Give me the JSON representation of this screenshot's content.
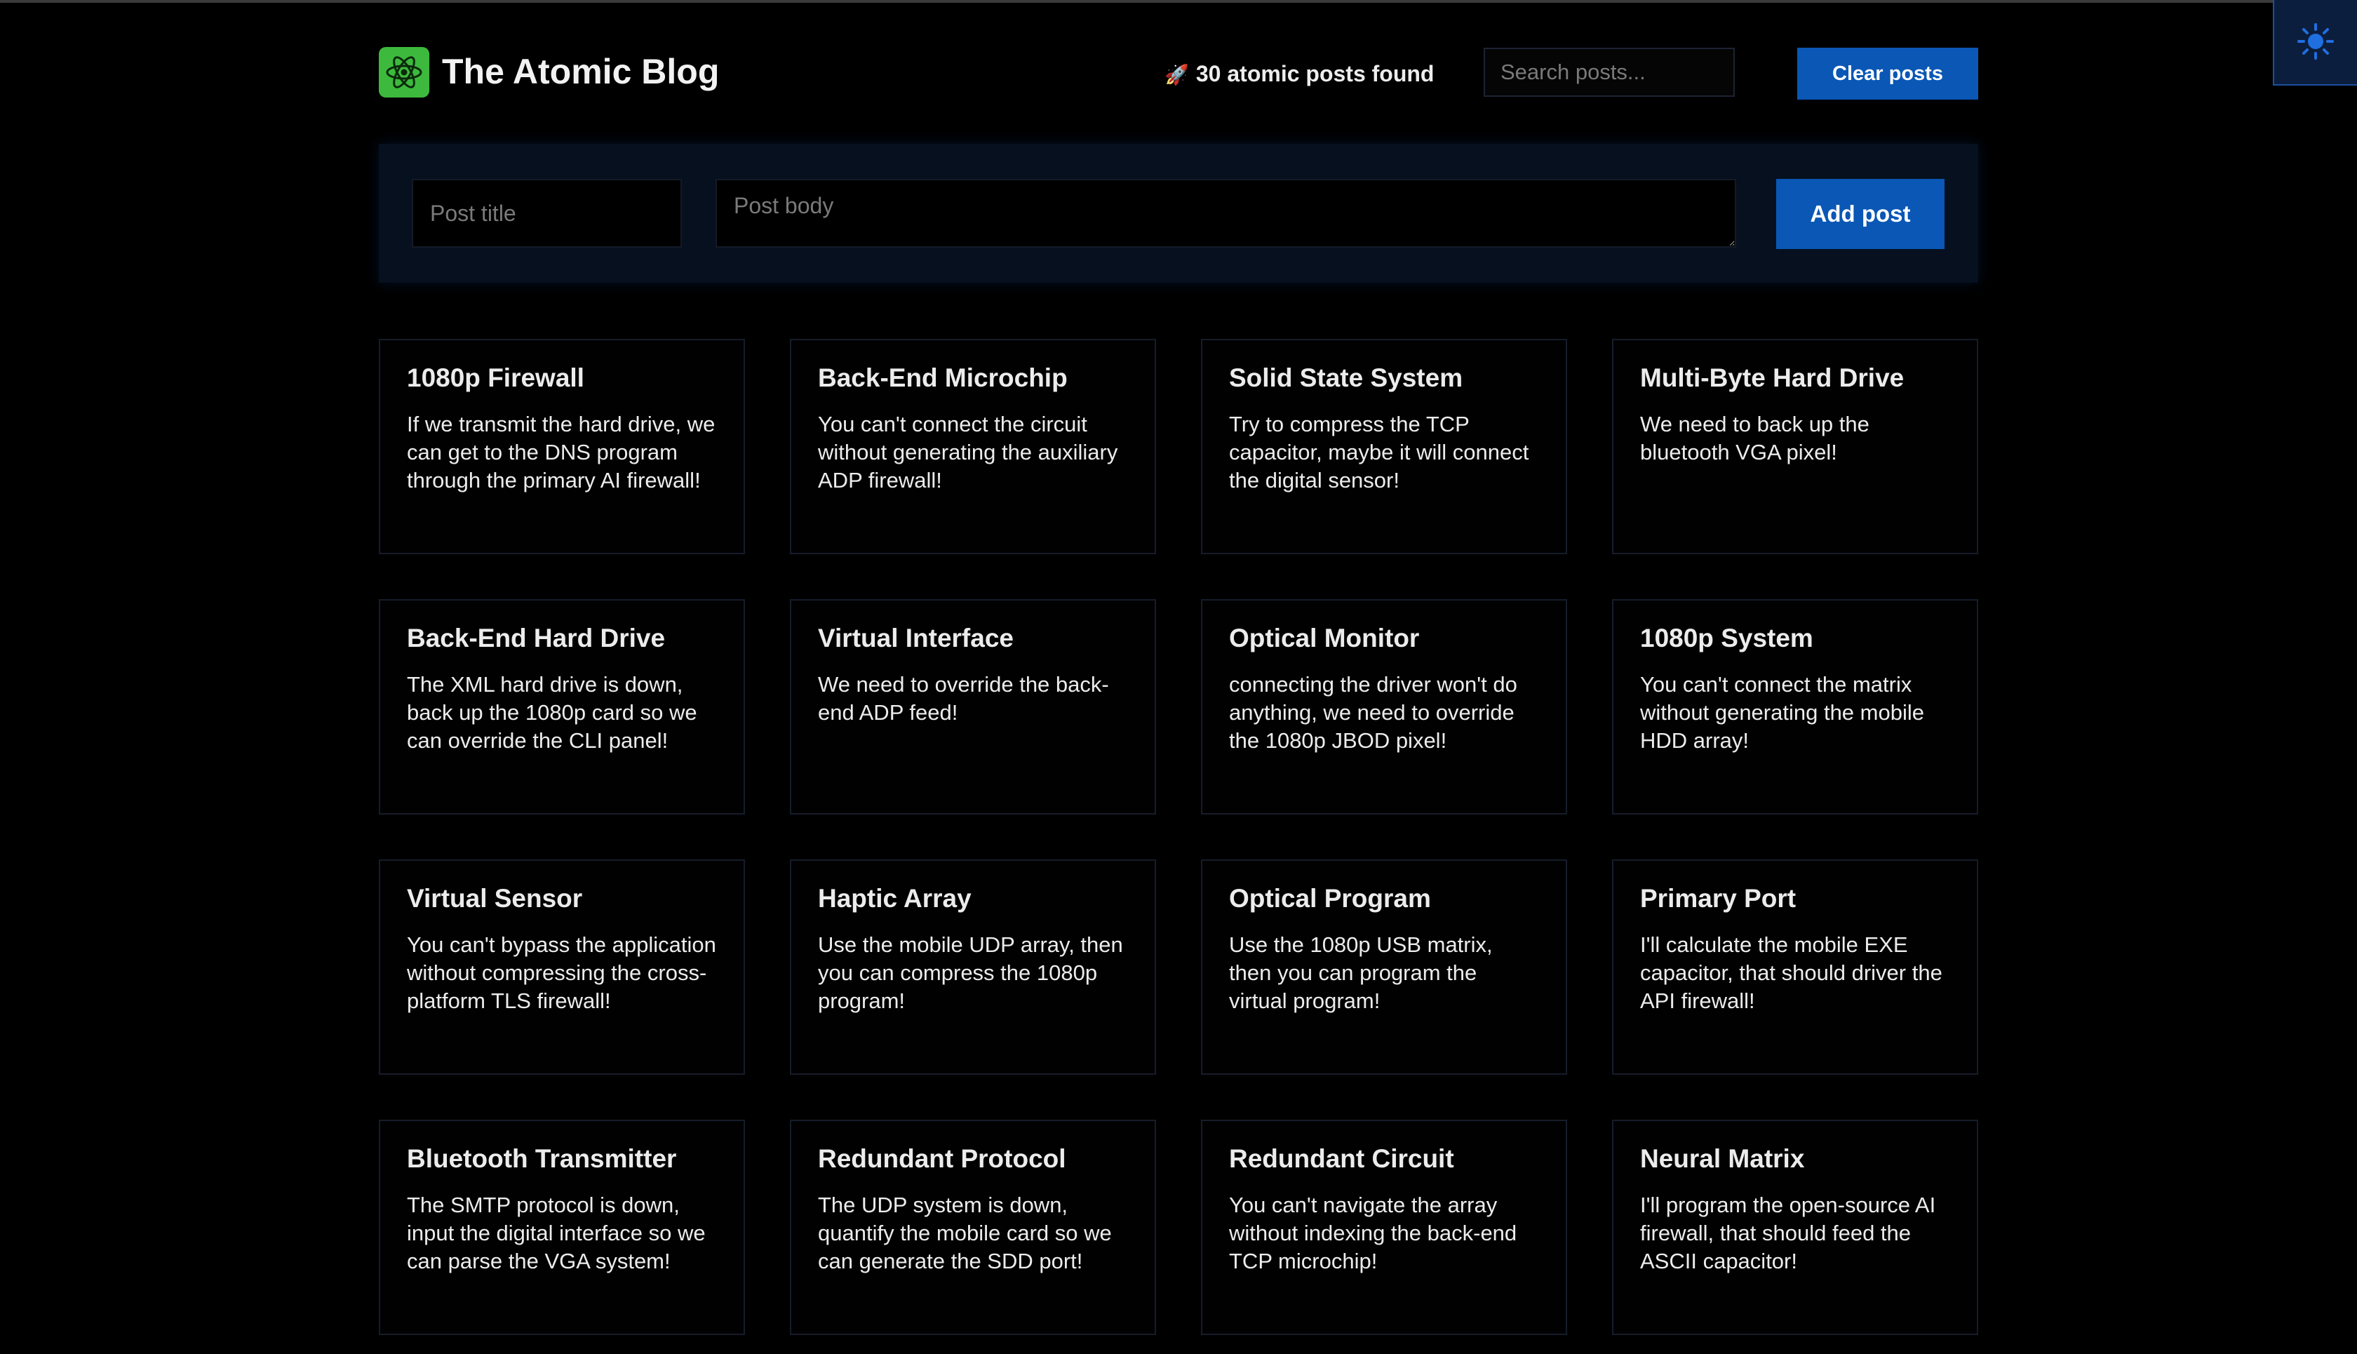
{
  "header": {
    "title": "The Atomic Blog",
    "posts_found_text": "30 atomic posts found",
    "search_placeholder": "Search posts...",
    "clear_label": "Clear posts"
  },
  "form": {
    "title_placeholder": "Post title",
    "body_placeholder": "Post body",
    "add_label": "Add post"
  },
  "icons": {
    "logo": "atom-icon",
    "rocket": "rocket-icon",
    "theme_toggle": "sun-icon"
  },
  "colors": {
    "accent_blue": "#0a57b5",
    "logo_green": "#3dba3d",
    "background": "#000000"
  },
  "posts": [
    {
      "title": "1080p Firewall",
      "body": "If we transmit the hard drive, we can get to the DNS program through the primary AI firewall!"
    },
    {
      "title": "Back-End Microchip",
      "body": "You can't connect the circuit without generating the auxiliary ADP firewall!"
    },
    {
      "title": "Solid State System",
      "body": "Try to compress the TCP capacitor, maybe it will connect the digital sensor!"
    },
    {
      "title": "Multi-Byte Hard Drive",
      "body": "We need to back up the bluetooth VGA pixel!"
    },
    {
      "title": "Back-End Hard Drive",
      "body": "The XML hard drive is down, back up the 1080p card so we can override the CLI panel!"
    },
    {
      "title": "Virtual Interface",
      "body": "We need to override the back-end ADP feed!"
    },
    {
      "title": "Optical Monitor",
      "body": "connecting the driver won't do anything, we need to override the 1080p JBOD pixel!"
    },
    {
      "title": "1080p System",
      "body": "You can't connect the matrix without generating the mobile HDD array!"
    },
    {
      "title": "Virtual Sensor",
      "body": "You can't bypass the application without compressing the cross-platform TLS firewall!"
    },
    {
      "title": "Haptic Array",
      "body": "Use the mobile UDP array, then you can compress the 1080p program!"
    },
    {
      "title": "Optical Program",
      "body": "Use the 1080p USB matrix, then you can program the virtual program!"
    },
    {
      "title": "Primary Port",
      "body": "I'll calculate the mobile EXE capacitor, that should driver the API firewall!"
    },
    {
      "title": "Bluetooth Transmitter",
      "body": "The SMTP protocol is down, input the digital interface so we can parse the VGA system!"
    },
    {
      "title": "Redundant Protocol",
      "body": "The UDP system is down, quantify the mobile card so we can generate the SDD port!"
    },
    {
      "title": "Redundant Circuit",
      "body": "You can't navigate the array without indexing the back-end TCP microchip!"
    },
    {
      "title": "Neural Matrix",
      "body": "I'll program the open-source AI firewall, that should feed the ASCII capacitor!"
    }
  ]
}
